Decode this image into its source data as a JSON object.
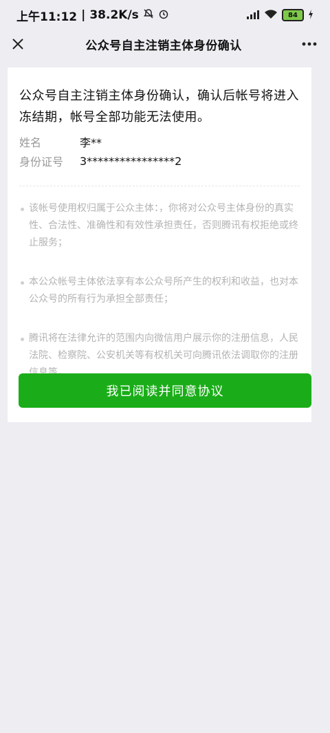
{
  "status_bar": {
    "time": "上午11:12",
    "speed": "38.2K/s",
    "battery": "84"
  },
  "nav": {
    "title": "公众号自主注销主体身份确认"
  },
  "card": {
    "intro": "公众号自主注销主体身份确认，确认后帐号将进入冻结期，帐号全部功能无法使用。",
    "fields": [
      {
        "label": "姓名",
        "value": "李**"
      },
      {
        "label": "身份证号",
        "value": "3****************2"
      }
    ],
    "terms": [
      "该帐号使用权归属于公众主体：，你将对公众号主体身份的真实性、合法性、准确性和有效性承担责任，否则腾讯有权拒绝或终止服务；",
      "本公众帐号主体依法享有本公众号所产生的权利和收益，也对本公众号的所有行为承担全部责任；",
      "腾讯将在法律允许的范围内向微信用户展示你的注册信息，人民法院、检察院、公安机关等有权机关可向腾讯依法调取你的注册信息等。"
    ],
    "agree_button": "我已阅读并同意协议"
  }
}
